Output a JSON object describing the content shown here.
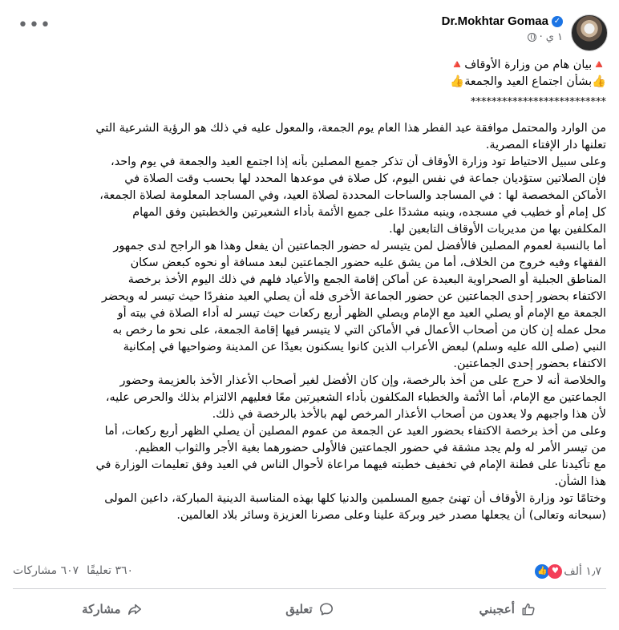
{
  "header": {
    "author_name": "Dr.Mokhtar Gomaa",
    "timestamp": "١ ي",
    "more_label": "•••"
  },
  "content": {
    "title_lines": [
      "🔺بيان هام من وزارة الأوقاف🔺",
      "👍بشأن اجتماع العيد والجمعة👍"
    ],
    "divider": "**************************",
    "body_lines": [
      "من الوارد والمحتمل موافقة عيد الفطر هذا العام يوم الجمعة، والمعول عليه في ذلك هو الرؤية الشرعية التي",
      "تعلنها دار الإفتاء المصرية.",
      "وعلى سبيل الاحتياط تود وزارة الأوقاف أن تذكر جميع المصلين بأنه إذا اجتمع العيد والجمعة في يوم واحد،",
      "فإن الصلاتين ستؤديان جماعة في نفس اليوم، كل صلاة في موعدها المحدد لها بحسب وقت الصلاة في",
      "الأماكن المخصصة لها : في المساجد والساحات المحددة لصلاة العيد، وفي المساجد المعلومة لصلاة الجمعة،",
      "كل إمام أو خطيب في مسجده، وينبه مشددًا على جميع الأئمة بأداء الشعيرتين والخطبتين وفق المهام",
      "المكلفين بها من مديريات الأوقاف التابعين لها.",
      "أما بالنسبة لعموم المصلين فالأفضل لمن يتيسر له حضور الجماعتين أن يفعل وهذا هو الراجح لدى جمهور",
      "الفقهاء وفيه خروج من الخلاف، أما من يشق عليه حضور الجماعتين لبعد مسافة أو نحوه كبعض سكان",
      "المناطق الجبلية أو الصحراوية البعيدة عن أماكن إقامة الجمع والأعياد فلهم في ذلك اليوم الأخذ برخصة",
      "الاكتفاء بحضور إحدى الجماعتين عن حضور الجماعة الأخرى فله أن يصلي العيد منفردًا حيث تيسر له ويحضر",
      "الجمعة مع الإمام أو يصلي العيد مع الإمام ويصلي الظهر أربع ركعات حيث تيسر له أداء الصلاة في بيته أو",
      "محل عمله إن كان من أصحاب الأعمال في الأماكن التي لا يتيسر فيها إقامة الجمعة، على نحو ما رخص به",
      "النبي (صلى الله عليه وسلم) لبعض الأعراب الذين كانوا يسكنون بعيدًا عن المدينة وضواحيها في إمكانية",
      "الاكتفاء بحضور إحدى الجماعتين.",
      "والخلاصة أنه لا حرج على من أخذ بالرخصة، وإن كان الأفضل لغير أصحاب الأعذار الأخذ بالعزيمة وحضور",
      "الجماعتين مع الإمام، أما الأئمة والخطباء المكلفون بأداء الشعيرتين معًا فعليهم الالتزام بذلك والحرص عليه،",
      "لأن هذا واجبهم ولا يعدون من أصحاب الأعذار المرخص لهم بالأخذ بالرخصة في ذلك.",
      "وعلى من أخذ برخصة الاكتفاء بحضور العيد عن الجمعة من عموم المصلين أن يصلي الظهر أربع ركعات، أما",
      "من تيسر الأمر له ولم يجد مشقة في حضور الجماعتين فالأولى حضورهما بغية الأجر والثواب العظيم.",
      "مع تأكيدنا على فطنة الإمام في تخفيف خطبته فيهما مراعاة لأحوال الناس في العيد وفق تعليمات الوزارة في",
      "هذا الشأن.",
      "وختامًا تود وزارة الأوقاف أن تهنئ جميع المسلمين والدنيا كلها بهذه المناسبة الدينية المباركة، داعين المولى",
      "(سبحانه وتعالى) أن يجعلها مصدر خير وبركة علينا وعلى مصرنا العزيزة وسائر بلاد العالمين."
    ]
  },
  "reactions": {
    "count": "١٫٧ ألف",
    "comments": "٣٦٠ تعليقًا",
    "shares": "٦٠٧ مشاركات"
  },
  "actions": {
    "like_label": "أعجبني",
    "comment_label": "تعليق",
    "share_label": "مشاركة"
  },
  "colors": {
    "accent": "#1b74e4",
    "love": "#f33e58",
    "secondary_text": "#65676b",
    "divider": "#ced0d4"
  }
}
